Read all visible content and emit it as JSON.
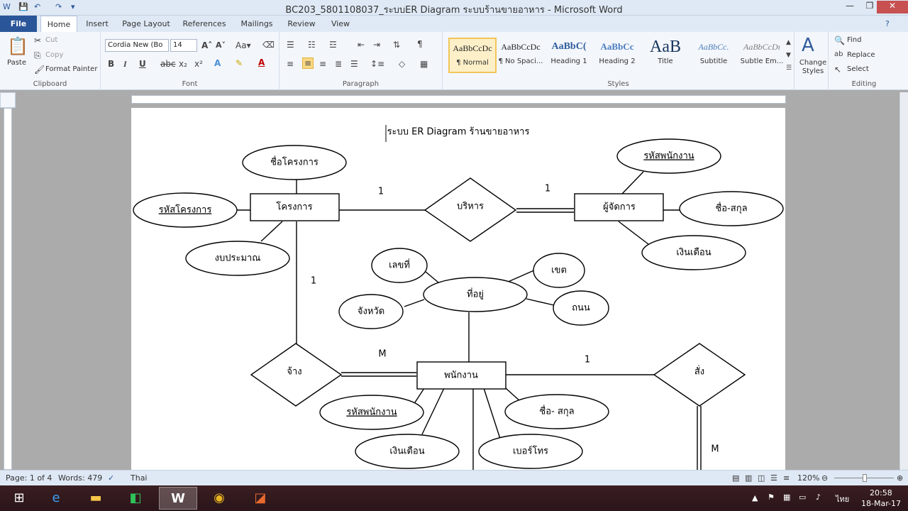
{
  "window": {
    "title": "BC203_5801108037_ระบบER Diagram ระบบร้านขายอาหาร - Microsoft Word"
  },
  "tabs": [
    {
      "label": "File"
    },
    {
      "label": "Home"
    },
    {
      "label": "Insert"
    },
    {
      "label": "Page Layout"
    },
    {
      "label": "References"
    },
    {
      "label": "Mailings"
    },
    {
      "label": "Review"
    },
    {
      "label": "View"
    }
  ],
  "ribbon": {
    "clipboard": {
      "paste": "Paste",
      "cut": "Cut",
      "copy": "Copy",
      "format_painter": "Format Painter",
      "label": "Clipboard"
    },
    "font": {
      "name": "Cordia New (Bo",
      "size": "14",
      "label": "Font"
    },
    "paragraph": {
      "label": "Paragraph"
    },
    "styles": {
      "items": [
        {
          "preview": "AaBbCcDc",
          "name": "¶ Normal"
        },
        {
          "preview": "AaBbCcDc",
          "name": "¶ No Spaci..."
        },
        {
          "preview": "AaBbC(",
          "name": "Heading 1"
        },
        {
          "preview": "AaBbCc",
          "name": "Heading 2"
        },
        {
          "preview": "AaB",
          "name": "Title"
        },
        {
          "preview": "AaBbCc.",
          "name": "Subtitle"
        },
        {
          "preview": "AaBbCcDı",
          "name": "Subtle Em..."
        }
      ],
      "change_styles": "Change Styles",
      "label": "Styles"
    },
    "editing": {
      "find": "Find",
      "replace": "Replace",
      "select": "Select",
      "label": "Editing"
    }
  },
  "document": {
    "heading": "ระบบ ER Diagram ร้านขายอาหาร",
    "entities": {
      "project": "โครงการ",
      "manager": "ผู้จัดการ",
      "employee": "พนักงาน"
    },
    "relationships": {
      "manage": "บริหาร",
      "hire": "จ้าง",
      "order": "สั่ง"
    },
    "attributes": {
      "project_name": "ชื่อโครงการ",
      "project_id": "รหัสโครงการ",
      "budget": "งบประมาณ",
      "mgr_emp_id": "รหัสพนักงาน",
      "mgr_fullname": "ชื่อ-สกุล",
      "mgr_salary": "เงินเดือน",
      "address": "ที่อยู่",
      "house_no": "เลขที่",
      "district": "เขต",
      "province": "จังหวัด",
      "road": "ถนน",
      "emp_id": "รหัสพนักงาน",
      "emp_fullname": "ชื่อ- สกุล",
      "emp_salary": "เงินเดือน",
      "phone": "เบอร์โทร"
    },
    "cardinality": {
      "c1": "1",
      "c2": "1",
      "c3": "1",
      "c4": "M",
      "c5": "1",
      "c6": "M"
    }
  },
  "statusbar": {
    "page": "Page: 1 of 4",
    "words": "Words: 479",
    "language": "Thai",
    "zoom": "120%"
  },
  "taskbar": {
    "lang": "ไทย",
    "time": "20:58",
    "date": "18-Mar-17"
  }
}
